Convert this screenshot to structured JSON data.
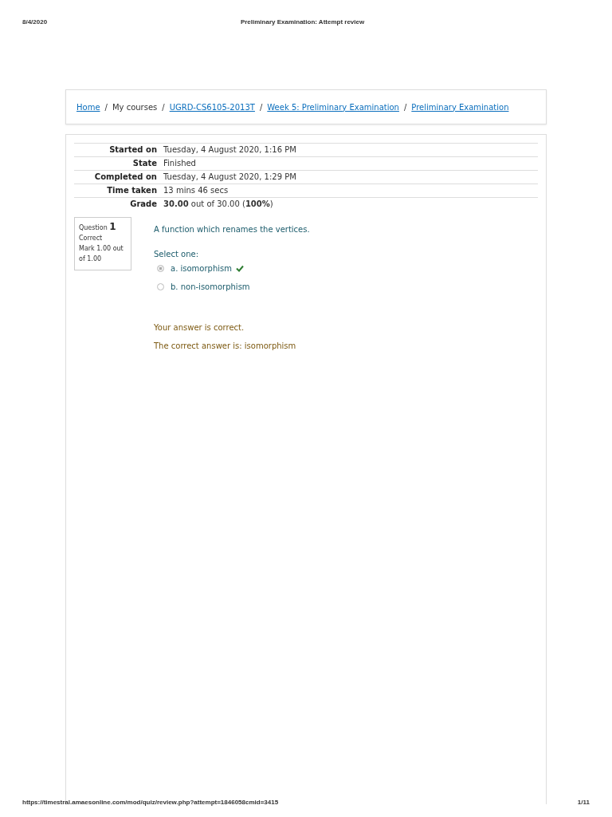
{
  "print_header": {
    "date": "8/4/2020",
    "title": "Preliminary Examination: Attempt review"
  },
  "breadcrumb": [
    {
      "label": "Home",
      "kind": "link",
      "separator": "/"
    },
    {
      "label": "My courses",
      "kind": "text",
      "separator": "/"
    },
    {
      "label": "UGRD-CS6105-2013T",
      "kind": "link",
      "separator": "/"
    },
    {
      "label": "Week 5: Preliminary Examination",
      "kind": "link",
      "separator": "/"
    },
    {
      "label": "Preliminary Examination",
      "kind": "link"
    }
  ],
  "summary": [
    {
      "label": "Started on",
      "value": "Tuesday, 4 August 2020, 1:16 PM"
    },
    {
      "label": "State",
      "value": "Finished"
    },
    {
      "label": "Completed on",
      "value": "Tuesday, 4 August 2020, 1:29 PM"
    },
    {
      "label": "Time taken",
      "value": "13 mins 46 secs"
    },
    {
      "label": "Grade",
      "value": "**30.00** out of 30.00 (**100%**)"
    }
  ],
  "question": {
    "label": "Question",
    "number": "1",
    "status": "Correct",
    "mark": "Mark 1.00 out of 1.00",
    "text": "A function which renames the vertices.",
    "prompt": "Select one:",
    "options": [
      {
        "label": "a. isomorphism",
        "selected": true,
        "correct": true
      },
      {
        "label": "b. non-isomorphism",
        "selected": false,
        "correct": false
      }
    ],
    "feedback": "Your answer is correct.",
    "right_answer": "The correct answer is: isomorphism"
  },
  "print_footer": {
    "url": "https://timestral.amaesonline.com/mod/quiz/review.php?attempt=1846058cmid=3415",
    "page": "1/11"
  }
}
